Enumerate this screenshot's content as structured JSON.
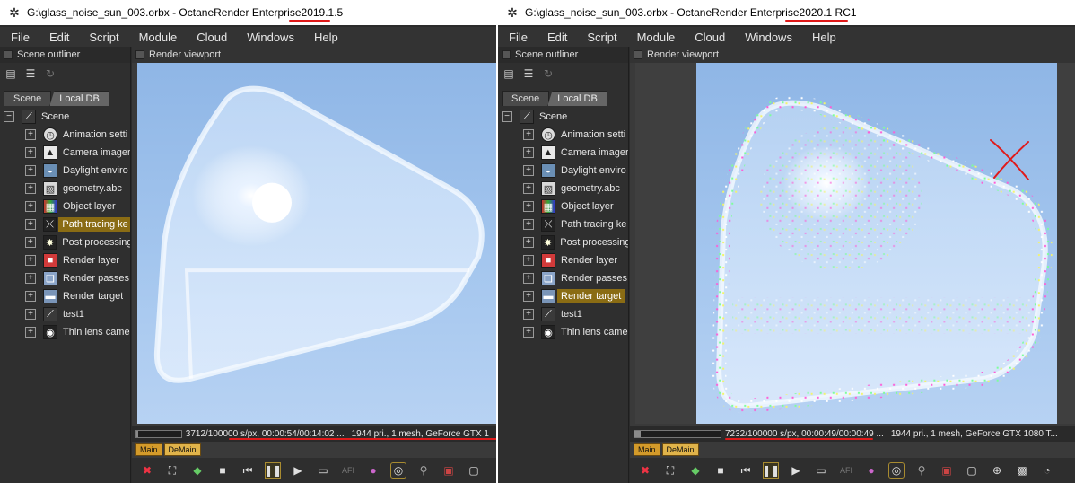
{
  "left_window": {
    "title_prefix": "G:\\glass_noise_sun_003.orbx - OctaneRender Enterprise ",
    "title_version": "2019.1.5",
    "menus": [
      "File",
      "Edit",
      "Script",
      "Module",
      "Cloud",
      "Windows",
      "Help"
    ],
    "outliner_title": "Scene outliner",
    "tabs": [
      "Scene",
      "Local DB"
    ],
    "tree_root": "Scene",
    "tree_items": [
      {
        "label": "Animation setti",
        "icon": "clock-icon"
      },
      {
        "label": "Camera imager",
        "icon": "camera-imager-icon"
      },
      {
        "label": "Daylight enviro",
        "icon": "daylight-icon"
      },
      {
        "label": "geometry.abc",
        "icon": "geometry-icon"
      },
      {
        "label": "Object layer",
        "icon": "object-layer-icon"
      },
      {
        "label": "Path tracing ke",
        "icon": "kernel-icon"
      },
      {
        "label": "Post processing",
        "icon": "post-processing-icon"
      },
      {
        "label": "Render layer",
        "icon": "render-layer-icon"
      },
      {
        "label": "Render passes",
        "icon": "render-passes-icon"
      },
      {
        "label": "Render target",
        "icon": "render-target-icon"
      },
      {
        "label": "test1",
        "icon": "node-graph-icon"
      },
      {
        "label": "Thin lens came",
        "icon": "thin-lens-camera-icon"
      }
    ],
    "selected_index": 5,
    "viewport_title": "Render viewport",
    "status_sample": "3712/100000 s/px, 00:00:54/00:14:02 ...",
    "status_info": "1944 pri., 1 mesh, GeForce GTX 1",
    "progress": 0.037,
    "render_tabs": [
      "Main",
      "DeMain"
    ]
  },
  "right_window": {
    "title_prefix": "G:\\glass_noise_sun_003.orbx - OctaneRender Enterprise ",
    "title_version": "2020.1 RC1",
    "menus": [
      "File",
      "Edit",
      "Script",
      "Module",
      "Cloud",
      "Windows",
      "Help"
    ],
    "outliner_title": "Scene outliner",
    "tabs": [
      "Scene",
      "Local DB"
    ],
    "tree_root": "Scene",
    "tree_items": [
      {
        "label": "Animation setti",
        "icon": "clock-icon"
      },
      {
        "label": "Camera imager",
        "icon": "camera-imager-icon"
      },
      {
        "label": "Daylight enviro",
        "icon": "daylight-icon"
      },
      {
        "label": "geometry.abc",
        "icon": "geometry-icon"
      },
      {
        "label": "Object layer",
        "icon": "object-layer-icon"
      },
      {
        "label": "Path tracing ke",
        "icon": "kernel-icon"
      },
      {
        "label": "Post processing",
        "icon": "post-processing-icon"
      },
      {
        "label": "Render layer",
        "icon": "render-layer-icon"
      },
      {
        "label": "Render passes",
        "icon": "render-passes-icon"
      },
      {
        "label": "Render target",
        "icon": "render-target-icon"
      },
      {
        "label": "test1",
        "icon": "node-graph-icon"
      },
      {
        "label": "Thin lens came",
        "icon": "thin-lens-camera-icon"
      }
    ],
    "selected_index": 9,
    "viewport_title": "Render viewport",
    "status_sample": "7232/100000 s/px, 00:00:49/00:00:49 ...",
    "status_info": "1944 pri., 1 mesh, GeForce GTX 1080 T...",
    "progress": 0.072,
    "render_tabs": [
      "Main",
      "DeMain"
    ]
  },
  "colors": {
    "annotation_red": "#e01a1a",
    "selection_gold": "#8a6c14",
    "sky_blue": "#9fc2ec"
  }
}
